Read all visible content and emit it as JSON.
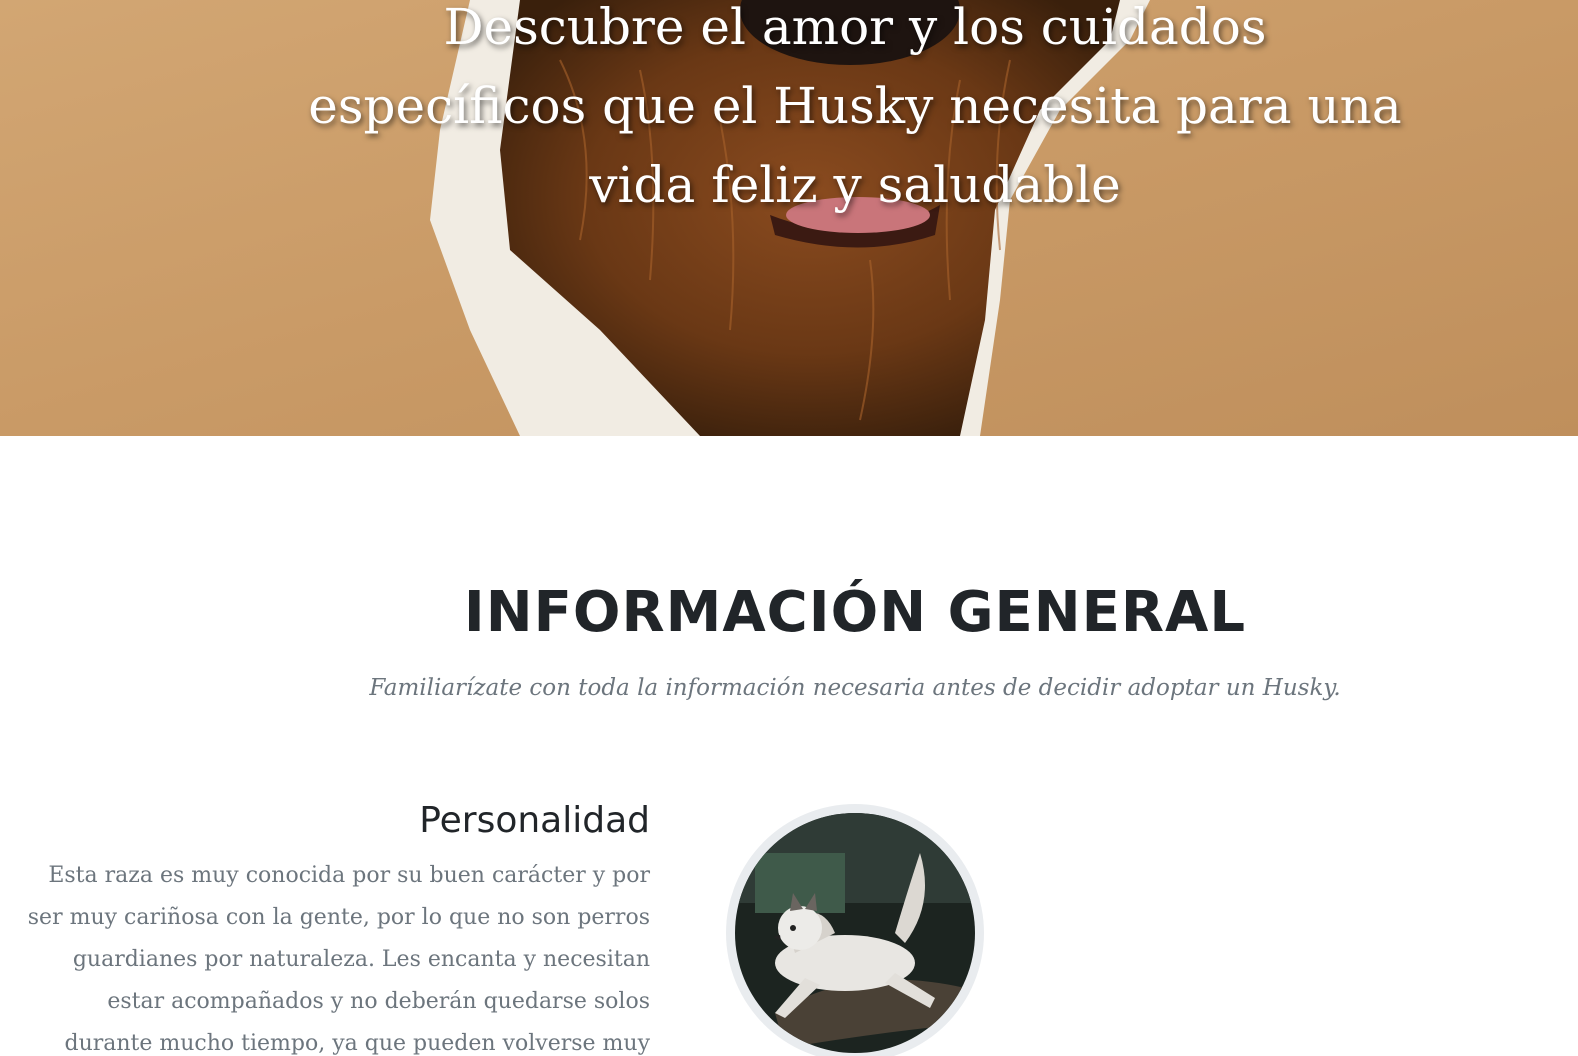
{
  "hero": {
    "heading": "Descubre el amor y los cuidados específicos que el Husky necesita para una vida feliz y saludable"
  },
  "info": {
    "title": "INFORMACIÓN GENERAL",
    "subtitle": "Familiarízate con toda la información necesaria antes de decidir adoptar un Husky."
  },
  "feature": {
    "title": "Personalidad",
    "text": "Esta raza es muy conocida por su buen carácter y por ser muy cariñosa con la gente, por lo que no son perros guardianes por naturaleza. Les encanta y necesitan estar acompañados y no deberán quedarse solos durante mucho tiempo, ya que pueden volverse muy"
  }
}
